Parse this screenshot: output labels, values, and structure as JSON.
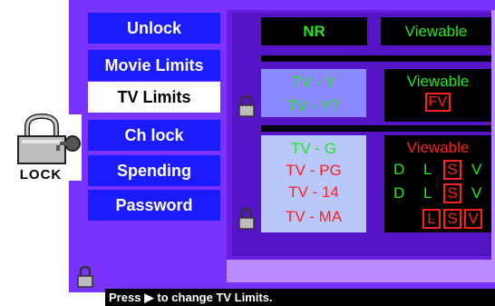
{
  "menu": {
    "items": [
      {
        "label": "Unlock"
      },
      {
        "label": "Movie Limits"
      },
      {
        "label": "TV Limits"
      },
      {
        "label": "Ch lock"
      },
      {
        "label": "Spending"
      },
      {
        "label": "Password"
      }
    ],
    "active_index": 2
  },
  "lock_panel": {
    "label": "LOCK"
  },
  "top_row": {
    "rating": "NR",
    "status": "Viewable"
  },
  "youth_group": {
    "ratings": [
      "TV - Y",
      "TV - Y7"
    ],
    "status": "Viewable",
    "flags": [
      "FV"
    ]
  },
  "general_group": {
    "ratings": [
      "TV - G",
      "TV - PG",
      "TV - 14",
      "TV - MA"
    ],
    "status": "Viewable",
    "row1": [
      "D",
      "L",
      "S",
      "V"
    ],
    "row2": [
      "D",
      "L",
      "S",
      "V"
    ],
    "row3": [
      "L",
      "S",
      "V"
    ]
  },
  "status_bar": {
    "text_before": "Press",
    "arrow": "▶",
    "text_after": "to change TV Limits."
  },
  "colors": {
    "menu_blue": "#1b1bff",
    "frame_purple": "#7a33ff",
    "active_item": "#ffffff",
    "viewable_green": "#23e523",
    "blocked_red": "#ff2020"
  }
}
